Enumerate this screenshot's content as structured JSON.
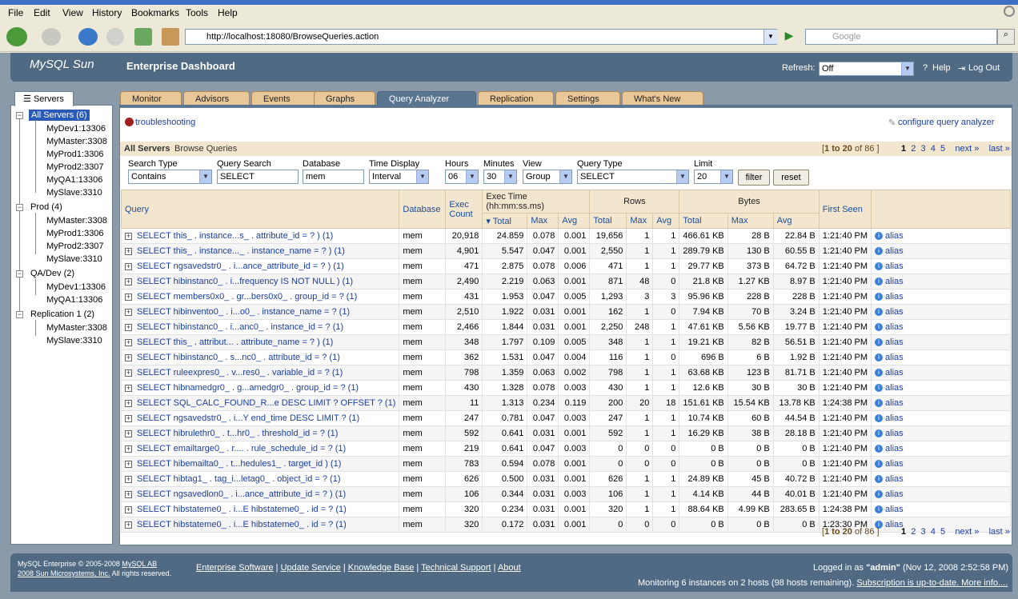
{
  "browser": {
    "menu": [
      "File",
      "Edit",
      "View",
      "History",
      "Bookmarks",
      "Tools",
      "Help"
    ],
    "url": "http://localhost:18080/BrowseQueries.action",
    "search_placeholder": "Google"
  },
  "header": {
    "logo": "MySQL Sun",
    "title": "Enterprise Dashboard",
    "refresh_label": "Refresh:",
    "refresh_value": "Off",
    "help": "Help",
    "logout": "Log Out"
  },
  "tabs": [
    "Monitor",
    "Advisors",
    "Events",
    "Graphs",
    "Query Analyzer",
    "Replication",
    "Settings",
    "What's New"
  ],
  "sidebar": {
    "tab_label": "Servers",
    "groups": [
      {
        "label": "All Servers (6)",
        "items": [
          "MyDev1:13306",
          "MyMaster:3308",
          "MyProd1:3306",
          "MyProd2:3307",
          "MyQA1:13306",
          "MySlave:3310"
        ]
      },
      {
        "label": "Prod (4)",
        "items": [
          "MyMaster:3308",
          "MyProd1:3306",
          "MyProd2:3307",
          "MySlave:3310"
        ]
      },
      {
        "label": "QA/Dev (2)",
        "items": [
          "MyDev1:13306",
          "MyQA1:13306"
        ]
      },
      {
        "label": "Replication 1 (2)",
        "items": [
          "MyMaster:3308",
          "MySlave:3310"
        ]
      }
    ]
  },
  "content": {
    "troubleshooting": "troubleshooting",
    "configure": "configure query analyzer",
    "title_bold": "All Servers",
    "title_rest": "Browse Queries",
    "range_prefix": "[",
    "range_bold": "1 to 20",
    "range_suffix": "of 86 ]",
    "pages": [
      "1",
      "2",
      "3",
      "4",
      "5"
    ],
    "next": "next »",
    "last": "last »"
  },
  "filters": {
    "search_type_label": "Search Type",
    "search_type_value": "Contains",
    "query_search_label": "Query Search",
    "query_search_value": "SELECT",
    "database_label": "Database",
    "database_value": "mem",
    "time_display_label": "Time Display",
    "time_display_value": "Interval",
    "hours_label": "Hours",
    "hours_value": "06",
    "minutes_label": "Minutes",
    "minutes_value": "30",
    "view_label": "View",
    "view_value": "Group",
    "query_type_label": "Query Type",
    "query_type_value": "SELECT",
    "limit_label": "Limit",
    "limit_value": "20",
    "filter_btn": "filter",
    "reset_btn": "reset"
  },
  "table": {
    "headers": {
      "query": "Query",
      "database": "Database",
      "exec_count": "Exec Count",
      "exec_time": "Exec Time (hh:mm:ss.ms)",
      "rows": "Rows",
      "bytes": "Bytes",
      "first_seen": "First Seen",
      "total": "Total",
      "max": "Max",
      "avg": "Avg"
    },
    "alias_label": "alias",
    "rows": [
      [
        "SELECT this_ . instance...s_ . attribute_id = ? ) (1)",
        "mem",
        "20,918",
        "24.859",
        "0.078",
        "0.001",
        "19,656",
        "1",
        "1",
        "466.61 KB",
        "28 B",
        "22.84 B",
        "1:21:40 PM"
      ],
      [
        "SELECT this_ . instance..._ . instance_name = ? ) (1)",
        "mem",
        "4,901",
        "5.547",
        "0.047",
        "0.001",
        "2,550",
        "1",
        "1",
        "289.79 KB",
        "130 B",
        "60.55 B",
        "1:21:40 PM"
      ],
      [
        "SELECT ngsavedstr0_ . i...ance_attribute_id = ? ) (1)",
        "mem",
        "471",
        "2.875",
        "0.078",
        "0.006",
        "471",
        "1",
        "1",
        "29.77 KB",
        "373 B",
        "64.72 B",
        "1:21:40 PM"
      ],
      [
        "SELECT hibinstanc0_ . i...frequency IS NOT NULL ) (1)",
        "mem",
        "2,490",
        "2.219",
        "0.063",
        "0.001",
        "871",
        "48",
        "0",
        "21.8 KB",
        "1.27 KB",
        "8.97 B",
        "1:21:40 PM"
      ],
      [
        "SELECT members0x0_ . gr...bers0x0_ . group_id = ? (1)",
        "mem",
        "431",
        "1.953",
        "0.047",
        "0.005",
        "1,293",
        "3",
        "3",
        "95.96 KB",
        "228 B",
        "228 B",
        "1:21:40 PM"
      ],
      [
        "SELECT hibinvento0_ . i...o0_ . instance_name = ? (1)",
        "mem",
        "2,510",
        "1.922",
        "0.031",
        "0.001",
        "162",
        "1",
        "0",
        "7.94 KB",
        "70 B",
        "3.24 B",
        "1:21:40 PM"
      ],
      [
        "SELECT hibinstanc0_ . i...anc0_ . instance_id = ? (1)",
        "mem",
        "2,466",
        "1.844",
        "0.031",
        "0.001",
        "2,250",
        "248",
        "1",
        "47.61 KB",
        "5.56 KB",
        "19.77 B",
        "1:21:40 PM"
      ],
      [
        "SELECT this_ . attribut... . attribute_name = ? ) (1)",
        "mem",
        "348",
        "1.797",
        "0.109",
        "0.005",
        "348",
        "1",
        "1",
        "19.21 KB",
        "82 B",
        "56.51 B",
        "1:21:40 PM"
      ],
      [
        "SELECT hibinstanc0_ . s...nc0_ . attribute_id = ? (1)",
        "mem",
        "362",
        "1.531",
        "0.047",
        "0.004",
        "116",
        "1",
        "0",
        "696 B",
        "6 B",
        "1.92 B",
        "1:21:40 PM"
      ],
      [
        "SELECT ruleexpres0_ . v...res0_ . variable_id = ? (1)",
        "mem",
        "798",
        "1.359",
        "0.063",
        "0.002",
        "798",
        "1",
        "1",
        "63.68 KB",
        "123 B",
        "81.71 B",
        "1:21:40 PM"
      ],
      [
        "SELECT hibnamedgr0_ . g...amedgr0_ . group_id = ? (1)",
        "mem",
        "430",
        "1.328",
        "0.078",
        "0.003",
        "430",
        "1",
        "1",
        "12.6 KB",
        "30 B",
        "30 B",
        "1:21:40 PM"
      ],
      [
        "SELECT SQL_CALC_FOUND_R...e DESC LIMIT ? OFFSET ? (1)",
        "mem",
        "11",
        "1.313",
        "0.234",
        "0.119",
        "200",
        "20",
        "18",
        "151.61 KB",
        "15.54 KB",
        "13.78 KB",
        "1:24:38 PM"
      ],
      [
        "SELECT ngsavedstr0_ . i...Y end_time DESC LIMIT ? (1)",
        "mem",
        "247",
        "0.781",
        "0.047",
        "0.003",
        "247",
        "1",
        "1",
        "10.74 KB",
        "60 B",
        "44.54 B",
        "1:21:40 PM"
      ],
      [
        "SELECT hibrulethr0_ . t...hr0_ . threshold_id = ? (1)",
        "mem",
        "592",
        "0.641",
        "0.031",
        "0.001",
        "592",
        "1",
        "1",
        "16.29 KB",
        "38 B",
        "28.18 B",
        "1:21:40 PM"
      ],
      [
        "SELECT emailtarge0_ . r.... . rule_schedule_id = ? (1)",
        "mem",
        "219",
        "0.641",
        "0.047",
        "0.003",
        "0",
        "0",
        "0",
        "0 B",
        "0 B",
        "0 B",
        "1:21:40 PM"
      ],
      [
        "SELECT hibemailta0_ . t...hedules1_ . target_id ) (1)",
        "mem",
        "783",
        "0.594",
        "0.078",
        "0.001",
        "0",
        "0",
        "0",
        "0 B",
        "0 B",
        "0 B",
        "1:21:40 PM"
      ],
      [
        "SELECT hibtag1_ . tag_i...letag0_ . object_id = ? (1)",
        "mem",
        "626",
        "0.500",
        "0.031",
        "0.001",
        "626",
        "1",
        "1",
        "24.89 KB",
        "45 B",
        "40.72 B",
        "1:21:40 PM"
      ],
      [
        "SELECT ngsavedlon0_ . i...ance_attribute_id = ? ) (1)",
        "mem",
        "106",
        "0.344",
        "0.031",
        "0.003",
        "106",
        "1",
        "1",
        "4.14 KB",
        "44 B",
        "40.01 B",
        "1:21:40 PM"
      ],
      [
        "SELECT hibstateme0_ . i...E hibstateme0_ . id = ? (1)",
        "mem",
        "320",
        "0.234",
        "0.031",
        "0.001",
        "320",
        "1",
        "1",
        "88.64 KB",
        "4.99 KB",
        "283.65 B",
        "1:24:38 PM"
      ],
      [
        "SELECT hibstateme0_ . i...E hibstateme0_ . id = ? (1)",
        "mem",
        "320",
        "0.172",
        "0.031",
        "0.001",
        "0",
        "0",
        "0",
        "0 B",
        "0 B",
        "0 B",
        "1:23:30 PM"
      ]
    ]
  },
  "footer": {
    "copyright_1": "MySQL Enterprise © 2005-2008",
    "copyright_link1": "MySQL AB",
    "copyright_link2": "2008 Sun Microsystems, Inc.",
    "copyright_2": "All rights reserved.",
    "links": [
      "Enterprise Software",
      "Update Service",
      "Knowledge Base",
      "Technical Support",
      "About"
    ],
    "logged_in_prefix": "Logged in as",
    "user": "\"admin\"",
    "logged_in_date": "(Nov 12, 2008 2:52:58 PM)",
    "monitoring": "Monitoring 6 instances on 2 hosts (98 hosts remaining).",
    "subscription": "Subscription is up-to-date. More info...."
  }
}
